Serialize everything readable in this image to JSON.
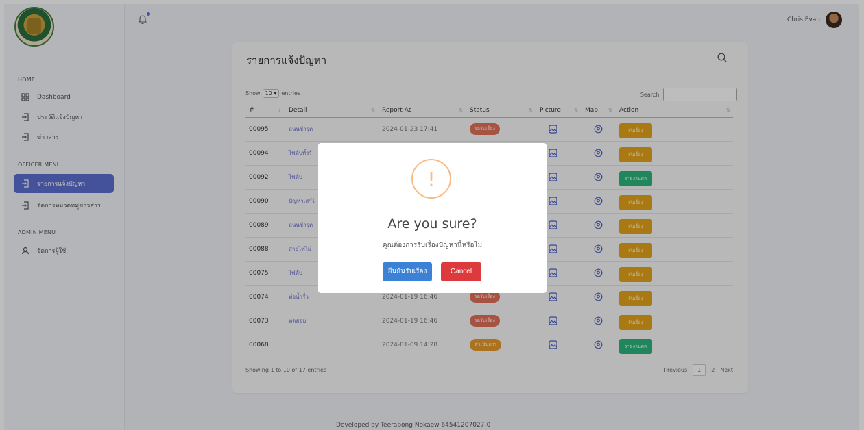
{
  "topbar": {
    "user_name": "Chris Evan"
  },
  "sidebar": {
    "sections": {
      "home": "HOME",
      "officer": "OFFICER MENU",
      "admin": "ADMIN MENU"
    },
    "items": [
      {
        "label": "Dashboard",
        "icon": "dashboard-icon"
      },
      {
        "label": "ประวัติแจ้งปัญหา",
        "icon": "login-icon"
      },
      {
        "label": "ข่าวสาร",
        "icon": "login-icon"
      },
      {
        "label": "รายการแจ้งปัญหา",
        "icon": "login-icon",
        "active": true
      },
      {
        "label": "จัดการหมวดหมู่ข่าวสาร",
        "icon": "login-icon"
      },
      {
        "label": "จัดการผู้ใช้",
        "icon": "user-icon"
      }
    ]
  },
  "card": {
    "title": "รายการแจ้งปัญหา",
    "show_label": "Show",
    "entries_select": "10",
    "entries_label": "entries",
    "search_label": "Search:",
    "columns": [
      "#",
      "Detail",
      "Report At",
      "Status",
      "Picture",
      "Map",
      "Action"
    ],
    "rows": [
      {
        "id": "00095",
        "detail": "ถนนชำรุด",
        "date": "2024-01-23 17:41",
        "status": "รอรับเรื่อง",
        "status_type": "wait",
        "action": "รับเรื่อง",
        "action_type": "accept"
      },
      {
        "id": "00094",
        "detail": "ไฟดับทั้งวั",
        "date": "",
        "status": "",
        "status_type": "",
        "action": "รับเรื่อง",
        "action_type": "accept"
      },
      {
        "id": "00092",
        "detail": "ไฟดับ",
        "date": "",
        "status": "",
        "status_type": "",
        "action": "รายงานผล",
        "action_type": "report"
      },
      {
        "id": "00090",
        "detail": "ปัญหาเสาไ",
        "date": "",
        "status": "",
        "status_type": "",
        "action": "รับเรื่อง",
        "action_type": "accept"
      },
      {
        "id": "00089",
        "detail": "ถนนชำรุด",
        "date": "",
        "status": "",
        "status_type": "",
        "action": "รับเรื่อง",
        "action_type": "accept"
      },
      {
        "id": "00088",
        "detail": "สายไฟไม่",
        "date": "",
        "status": "",
        "status_type": "",
        "action": "รับเรื่อง",
        "action_type": "accept"
      },
      {
        "id": "00075",
        "detail": "ไฟดับ",
        "date": "",
        "status": "",
        "status_type": "",
        "action": "รับเรื่อง",
        "action_type": "accept"
      },
      {
        "id": "00074",
        "detail": "ท่อน้ำรั่ว",
        "date": "2024-01-19 16:46",
        "status": "รอรับเรื่อง",
        "status_type": "wait",
        "action": "รับเรื่อง",
        "action_type": "accept"
      },
      {
        "id": "00073",
        "detail": "ทดสอบ",
        "date": "2024-01-19 16:46",
        "status": "รอรับเรื่อง",
        "status_type": "wait",
        "action": "รับเรื่อง",
        "action_type": "accept"
      },
      {
        "id": "00068",
        "detail": "...",
        "date": "2024-01-09 14:28",
        "status": "ดำเนินการ",
        "status_type": "doing",
        "action": "รายงานผล",
        "action_type": "report"
      }
    ],
    "info": "Showing 1 to 10 of 17 entries",
    "pager": {
      "previous": "Previous",
      "current": "1",
      "page2": "2",
      "next": "Next"
    }
  },
  "footer": "Developed by Teerapong Nokaew 64541207027-0",
  "modal": {
    "icon_glyph": "!",
    "title": "Are you sure?",
    "text": "คุณต้องการรับเรื่องปัญหานี้หรือไม่",
    "confirm": "ยืนยันรับเรื่อง",
    "cancel": "Cancel"
  },
  "colors": {
    "accent": "#5b6fd1",
    "pending": "#e2705a",
    "in_progress": "#e79a2a",
    "accept_button": "#e4a51b",
    "report_button": "#2ab77b",
    "confirm_button": "#3b82d6",
    "cancel_button": "#dd3a3e",
    "warning": "#f8bb86"
  }
}
